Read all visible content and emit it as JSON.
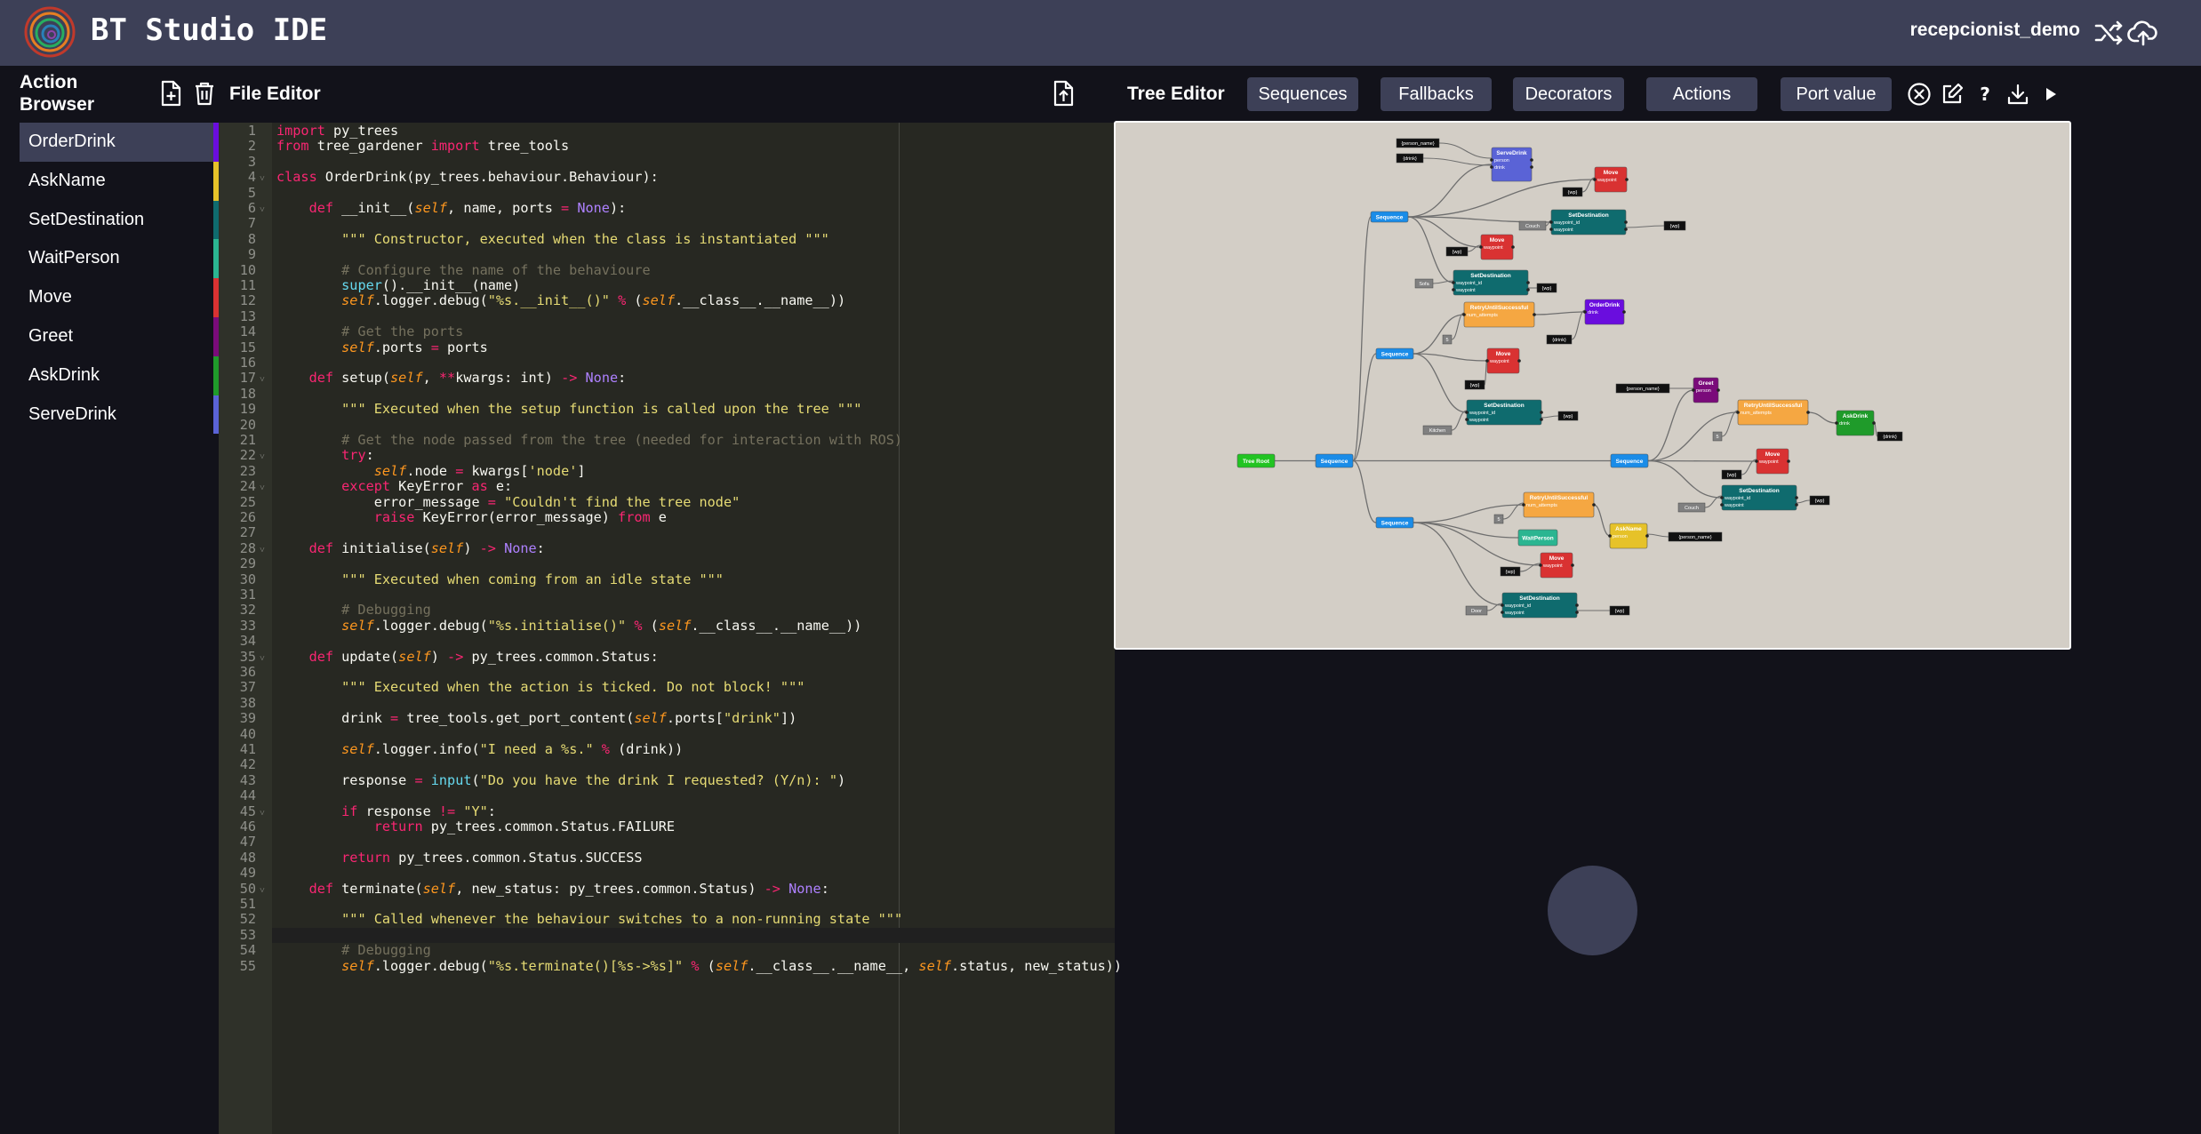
{
  "app": {
    "title": "BT Studio IDE",
    "project": "recepcionist_demo"
  },
  "action_browser": {
    "title": "Action Browser",
    "items": [
      {
        "label": "OrderDrink",
        "color": "#6a0dde"
      },
      {
        "label": "AskName",
        "color": "#e6c229"
      },
      {
        "label": "SetDestination",
        "color": "#0f6b6e"
      },
      {
        "label": "WaitPerson",
        "color": "#2bb591"
      },
      {
        "label": "Move",
        "color": "#d93232"
      },
      {
        "label": "Greet",
        "color": "#7a0b7a"
      },
      {
        "label": "AskDrink",
        "color": "#1f9b2a"
      },
      {
        "label": "ServeDrink",
        "color": "#5a63d6"
      }
    ]
  },
  "file_editor": {
    "title": "File Editor",
    "lines": [
      "import py_trees",
      "from tree_gardener import tree_tools",
      "",
      "class OrderDrink(py_trees.behaviour.Behaviour):",
      "",
      "    def __init__(self, name, ports = None):",
      "",
      "        \"\"\" Constructor, executed when the class is instantiated \"\"\"",
      "",
      "        # Configure the name of the behavioure",
      "        super().__init__(name)",
      "        self.logger.debug(\"%s.__init__()\" % (self.__class__.__name__))",
      "",
      "        # Get the ports",
      "        self.ports = ports",
      "",
      "    def setup(self, **kwargs: int) -> None:",
      "",
      "        \"\"\" Executed when the setup function is called upon the tree \"\"\"",
      "",
      "        # Get the node passed from the tree (needed for interaction with ROS)",
      "        try:",
      "            self.node = kwargs['node']",
      "        except KeyError as e:",
      "            error_message = \"Couldn't find the tree node\"",
      "            raise KeyError(error_message) from e",
      "",
      "    def initialise(self) -> None:",
      "",
      "        \"\"\" Executed when coming from an idle state \"\"\"",
      "",
      "        # Debugging",
      "        self.logger.debug(\"%s.initialise()\" % (self.__class__.__name__))",
      "",
      "    def update(self) -> py_trees.common.Status:",
      "",
      "        \"\"\" Executed when the action is ticked. Do not block! \"\"\"",
      "",
      "        drink = tree_tools.get_port_content(self.ports[\"drink\"])",
      "",
      "        self.logger.info(\"I need a %s.\" % (drink))",
      "",
      "        response = input(\"Do you have the drink I requested? (Y/n): \")",
      "",
      "        if response != \"Y\":",
      "            return py_trees.common.Status.FAILURE",
      "",
      "        return py_trees.common.Status.SUCCESS",
      "",
      "    def terminate(self, new_status: py_trees.common.Status) -> None:",
      "",
      "        \"\"\" Called whenever the behaviour switches to a non-running state \"\"\"",
      "",
      "        # Debugging",
      "        self.logger.debug(\"%s.terminate()[%s->%s]\" % (self.__class__.__name__, self.status, new_status))"
    ],
    "fold_lines": [
      4,
      6,
      17,
      22,
      24,
      28,
      35,
      45,
      50
    ]
  },
  "tree_editor": {
    "title": "Tree Editor",
    "buttons": [
      "Sequences",
      "Fallbacks",
      "Decorators",
      "Actions",
      "Port value"
    ],
    "nodes": [
      {
        "id": "root",
        "label": "Tree Root",
        "type": "root",
        "color": "#22c422"
      },
      {
        "id": "seq0",
        "label": "Sequence",
        "type": "seq",
        "color": "#1a8ce8"
      },
      {
        "id": "seq1",
        "label": "Sequence",
        "type": "seq",
        "color": "#1a8ce8"
      },
      {
        "id": "seq2",
        "label": "Sequence",
        "type": "seq",
        "color": "#1a8ce8"
      },
      {
        "id": "seq3",
        "label": "Sequence",
        "type": "seq",
        "color": "#1a8ce8"
      },
      {
        "id": "seq4",
        "label": "Sequence",
        "type": "seq",
        "color": "#1a8ce8"
      },
      {
        "id": "serve",
        "label": "ServeDrink",
        "ports": [
          "person",
          "drink"
        ],
        "color": "#5a63d6"
      },
      {
        "id": "mv1",
        "label": "Move",
        "ports": [
          "waypoint"
        ],
        "color": "#d93232"
      },
      {
        "id": "sd1",
        "label": "SetDestination",
        "ports": [
          "waypoint_id",
          "waypoint"
        ],
        "color": "#0f6b6e"
      },
      {
        "id": "mv2",
        "label": "Move",
        "ports": [
          "waypoint"
        ],
        "color": "#d93232"
      },
      {
        "id": "sd2",
        "label": "SetDestination",
        "ports": [
          "waypoint_id",
          "waypoint"
        ],
        "color": "#0f6b6e"
      },
      {
        "id": "rs1",
        "label": "RetryUntilSuccessful",
        "ports": [
          "num_attempts"
        ],
        "color": "#f5a742"
      },
      {
        "id": "od",
        "label": "OrderDrink",
        "ports": [
          "drink"
        ],
        "color": "#6a0dde"
      },
      {
        "id": "mv3",
        "label": "Move",
        "ports": [
          "waypoint"
        ],
        "color": "#d93232"
      },
      {
        "id": "sd3",
        "label": "SetDestination",
        "ports": [
          "waypoint_id",
          "waypoint"
        ],
        "color": "#0f6b6e"
      },
      {
        "id": "greet",
        "label": "Greet",
        "ports": [
          "person"
        ],
        "color": "#7a0b7a"
      },
      {
        "id": "rs2",
        "label": "RetryUntilSuccessful",
        "ports": [
          "num_attempts"
        ],
        "color": "#f5a742"
      },
      {
        "id": "ask",
        "label": "AskDrink",
        "ports": [
          "drink"
        ],
        "color": "#1f9b2a"
      },
      {
        "id": "mv4",
        "label": "Move",
        "ports": [
          "waypoint"
        ],
        "color": "#d93232"
      },
      {
        "id": "sd4",
        "label": "SetDestination",
        "ports": [
          "waypoint_id",
          "waypoint"
        ],
        "color": "#0f6b6e"
      },
      {
        "id": "rs3",
        "label": "RetryUntilSuccessful",
        "ports": [
          "num_attempts"
        ],
        "color": "#f5a742"
      },
      {
        "id": "wp",
        "label": "WaitPerson",
        "ports": [],
        "color": "#2bb591"
      },
      {
        "id": "an",
        "label": "AskName",
        "ports": [
          "person"
        ],
        "color": "#e6c229"
      },
      {
        "id": "mv5",
        "label": "Move",
        "ports": [
          "waypoint"
        ],
        "color": "#d93232"
      },
      {
        "id": "sd5",
        "label": "SetDestination",
        "ports": [
          "waypoint_id",
          "waypoint"
        ],
        "color": "#0f6b6e"
      }
    ],
    "port_values": [
      "{person_name}",
      "{drink}",
      "{wp}",
      "Couch",
      "{wp}",
      "{wp}",
      "Sofa",
      "{wp}",
      "5",
      "{drink}",
      "{wp}",
      "Kitchen",
      "{wp}",
      "{person_name}",
      "5",
      "{drink}",
      "{wp}",
      "Couch",
      "{wp}",
      "5",
      "{person_name}",
      "{wp}",
      "Door",
      "{wp}"
    ]
  }
}
